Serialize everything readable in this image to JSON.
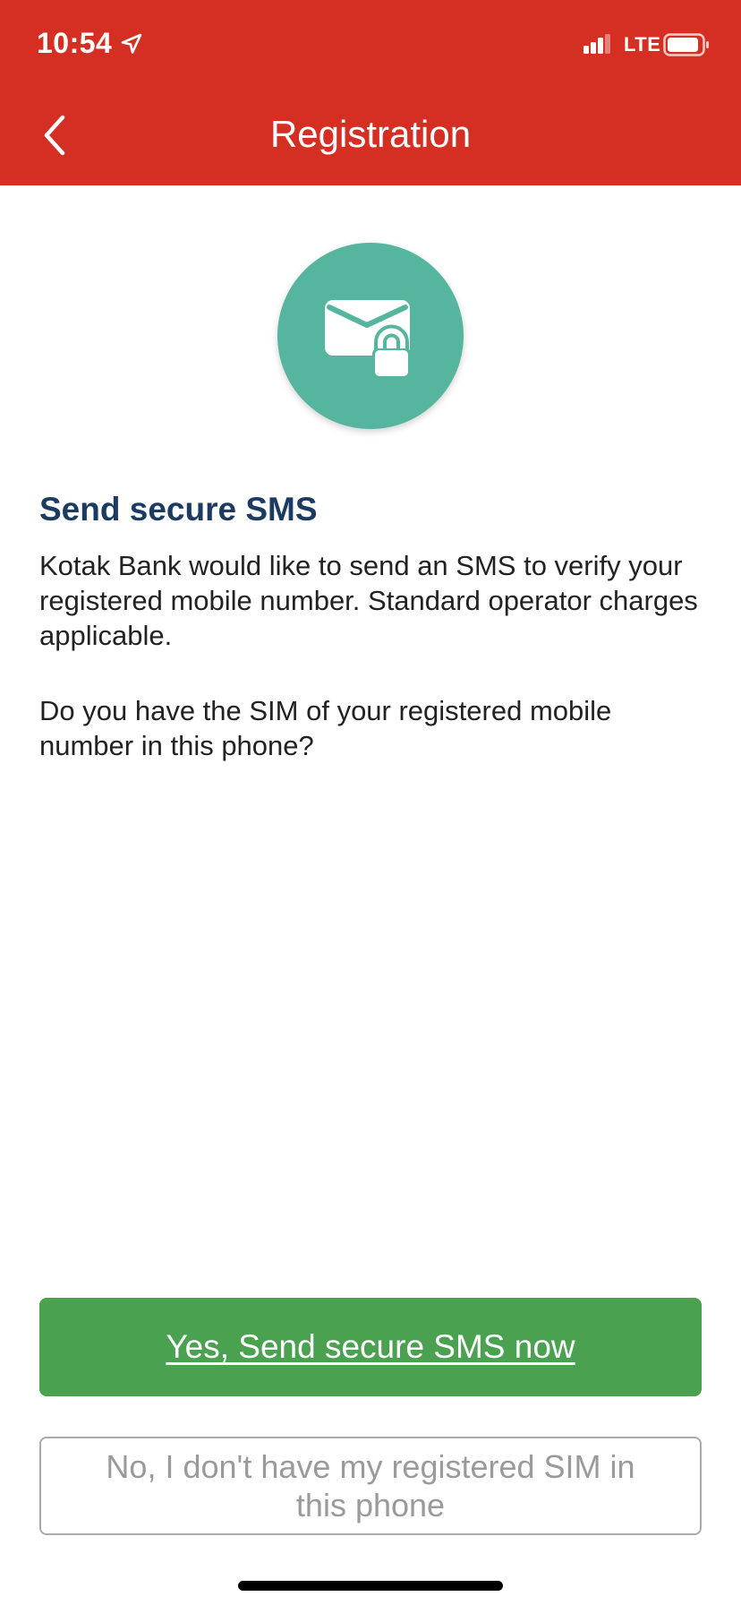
{
  "status_bar": {
    "time": "10:54",
    "network": "LTE",
    "location_icon": "location-arrow-icon",
    "signal_icon": "cellular-signal-icon",
    "battery_icon": "battery-icon"
  },
  "nav": {
    "title": "Registration",
    "back_icon": "chevron-left-icon"
  },
  "hero": {
    "icon": "envelope-lock-icon"
  },
  "content": {
    "heading": "Send secure SMS",
    "paragraph_1": "Kotak Bank would like to send an SMS to verify your registered mobile number. Standard operator charges applicable.",
    "paragraph_2": "Do you have the SIM of your registered mobile number in this phone?"
  },
  "actions": {
    "primary_label": "Yes, Send secure SMS now",
    "secondary_label": "No, I don't have my registered SIM in this phone"
  },
  "colors": {
    "header_bg": "#d42f22",
    "hero_bg": "#55b59f",
    "heading_text": "#1c3b63",
    "primary_button": "#4aa14f",
    "secondary_border": "#aaaaaa"
  }
}
